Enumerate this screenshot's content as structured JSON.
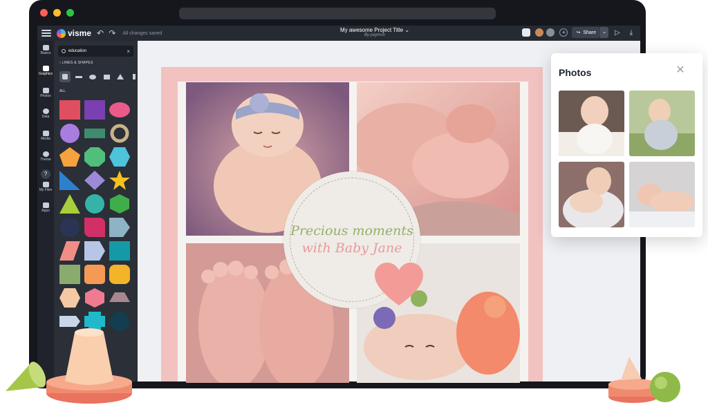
{
  "topbar": {
    "brand": "visme",
    "undo_redo": "↶ ↷",
    "save_status": "All changes saved",
    "project_title": "My awesome Project Title",
    "project_title_caret": "⌄",
    "byline": "By paymon",
    "share_label": "Share",
    "share_caret": "⌄",
    "add_collaborator": "+",
    "play_icon": "▷",
    "download_icon": "⤓",
    "share_icon": "↪"
  },
  "sidebar": {
    "items": [
      {
        "label": "Basics",
        "icon": "basics-icon"
      },
      {
        "label": "Graphics",
        "icon": "graphics-icon"
      },
      {
        "label": "Photos",
        "icon": "photos-icon"
      },
      {
        "label": "Data",
        "icon": "data-icon"
      },
      {
        "label": "Media",
        "icon": "media-icon"
      },
      {
        "label": "Theme",
        "icon": "theme-icon"
      },
      {
        "label": "My Files",
        "icon": "my-files-icon"
      },
      {
        "label": "Apps",
        "icon": "apps-icon"
      }
    ],
    "help": "?"
  },
  "panel": {
    "search_value": "education",
    "clear": "×",
    "breadcrumb": "‹ LINES & SHAPES",
    "all_label": "ALL"
  },
  "canvas": {
    "badge_line1": "Precious moments",
    "badge_line2": "with Baby Jane"
  },
  "photos_popup": {
    "title": "Photos",
    "close": "✕"
  },
  "colors": {
    "accent_pink": "#f2c2c0",
    "heart": "#f29b97",
    "title_green": "#94b06d",
    "title_pink": "#e99a9c"
  }
}
